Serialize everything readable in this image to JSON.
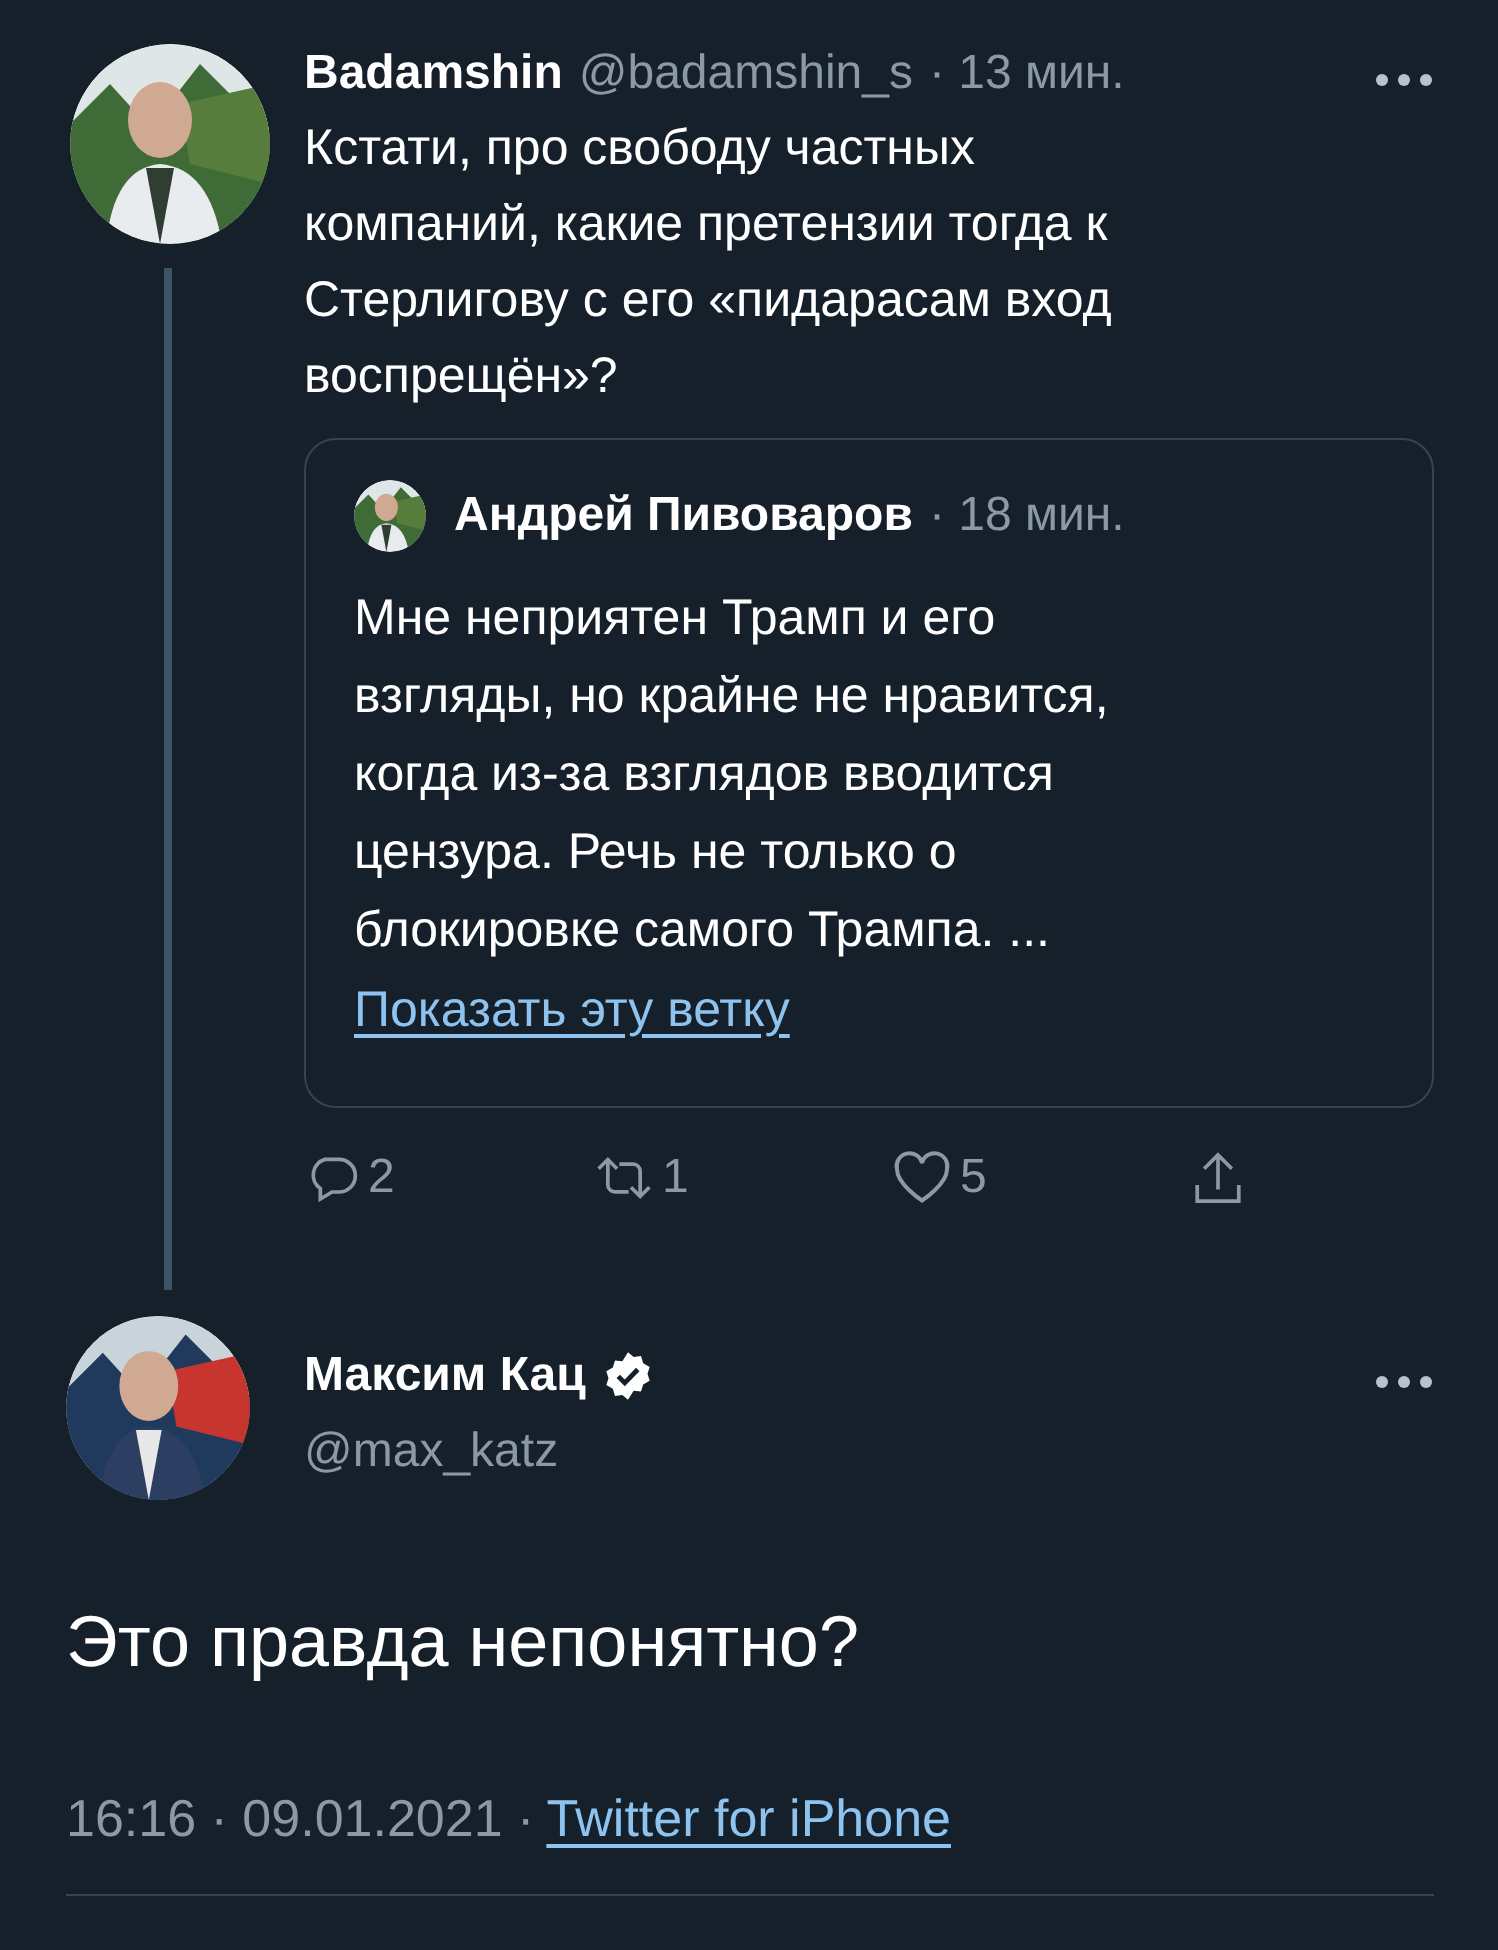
{
  "tweets": [
    {
      "kind": "thread",
      "author": {
        "name": "Badamshin",
        "handle": "@badamshin_s",
        "verified": false
      },
      "time": "· 13 мин.",
      "text": "Кстати, про свободу частных\nкомпаний, какие претензии тогда к\nСтерлигову с его «пидарасам вход\nвоспрещён»?",
      "quote": {
        "author": "Андрей Пивоваров",
        "time": "· 18 мин.",
        "text": "Мне неприятен Трамп и его\nвзгляды, но крайне не нравится,\nкогда из-за взглядов вводится\nцензура. Речь не только о\nблокировке самого Трампа. ...",
        "link": "Показать эту ветку"
      },
      "actions": [
        {
          "kind": "reply",
          "count": "2"
        },
        {
          "kind": "retweet",
          "count": "1"
        },
        {
          "kind": "like",
          "count": "5"
        },
        {
          "kind": "share"
        }
      ]
    },
    {
      "kind": "focused",
      "author": {
        "name": "Максим Кац",
        "handle": "@max_katz",
        "verified": true
      },
      "text": "Это правда непонятно?",
      "meta": "16:16 · 09.01.2021 ·",
      "source": "Twitter for iPhone"
    }
  ]
}
